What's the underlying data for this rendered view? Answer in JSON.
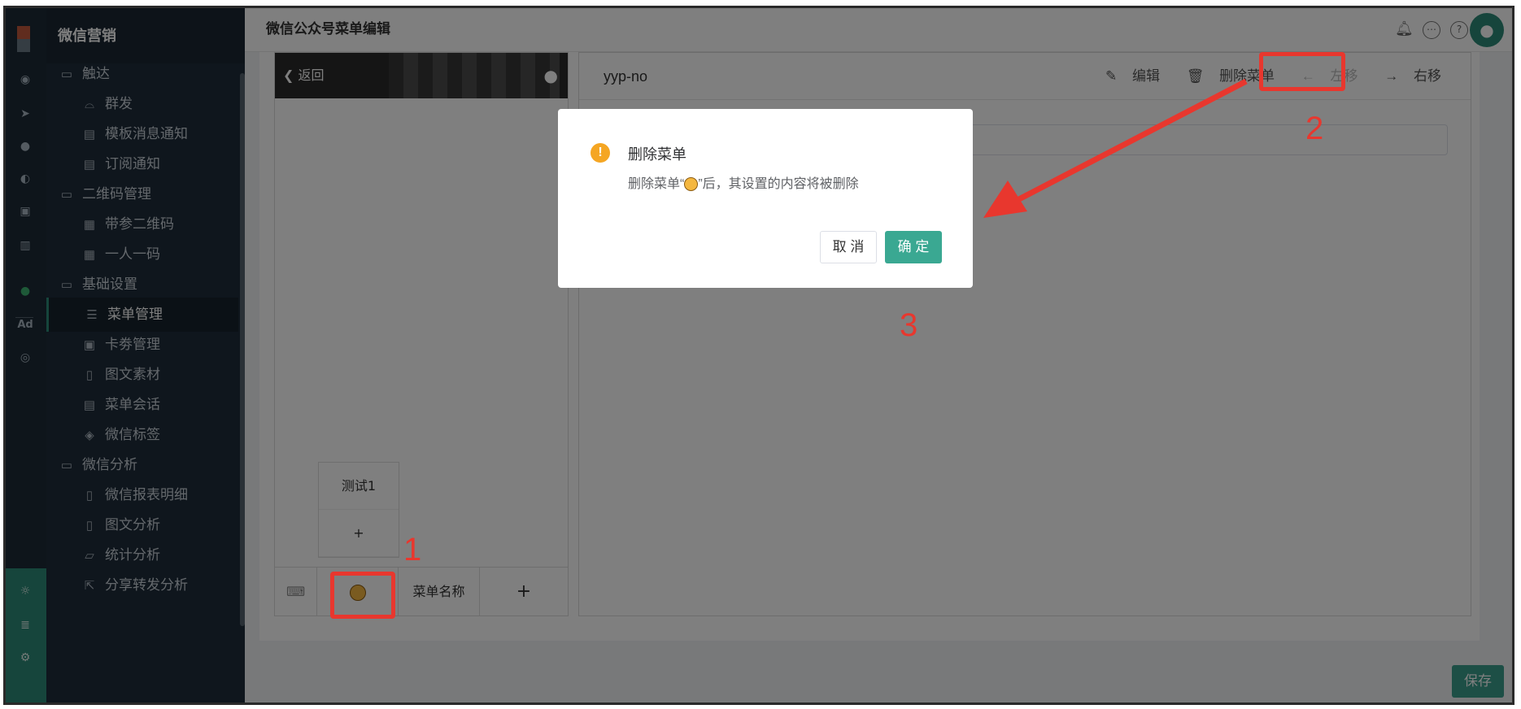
{
  "sidebar": {
    "brand": "微信营销",
    "items": [
      {
        "label": "触达",
        "icon": "folder-icon"
      },
      {
        "label": "群发",
        "icon": "broadcast-icon"
      },
      {
        "label": "模板消息通知",
        "icon": "template-icon"
      },
      {
        "label": "订阅通知",
        "icon": "subscribe-icon"
      },
      {
        "label": "二维码管理",
        "icon": "folder-icon"
      },
      {
        "label": "带参二维码",
        "icon": "qrcode-icon"
      },
      {
        "label": "一人一码",
        "icon": "qrcode-icon"
      },
      {
        "label": "基础设置",
        "icon": "folder-icon"
      },
      {
        "label": "菜单管理",
        "icon": "list-icon"
      },
      {
        "label": "卡劵管理",
        "icon": "card-icon"
      },
      {
        "label": "图文素材",
        "icon": "article-icon"
      },
      {
        "label": "菜单会话",
        "icon": "chat-icon"
      },
      {
        "label": "微信标签",
        "icon": "tag-icon"
      },
      {
        "label": "微信分析",
        "icon": "folder-icon"
      },
      {
        "label": "微信报表明细",
        "icon": "report-icon"
      },
      {
        "label": "图文分析",
        "icon": "report-icon"
      },
      {
        "label": "统计分析",
        "icon": "chart-icon"
      },
      {
        "label": "分享转发分析",
        "icon": "share-icon"
      }
    ],
    "rail_ad": "Ad"
  },
  "header": {
    "title": "微信公众号菜单编辑"
  },
  "phone": {
    "back": "返回",
    "submenu": [
      "测试1",
      "+"
    ],
    "menu_name": "菜单名称",
    "add": "+"
  },
  "editor": {
    "title": "yyp-no",
    "actions": {
      "edit": "编辑",
      "delete": "删除菜单",
      "left": "左移",
      "right": "右移"
    }
  },
  "save_label": "保存",
  "dialog": {
    "title": "删除菜单",
    "message_prefix": "删除菜单“",
    "message_suffix": "”后，其设置的内容将被删除",
    "cancel": "取 消",
    "ok": "确 定",
    "warn_glyph": "!"
  },
  "annotations": {
    "one": "1",
    "two": "2",
    "three": "3",
    "color": "#e8372e"
  },
  "colors": {
    "accent": "#2d8a78",
    "sidebar": "#1f2d3a",
    "warning": "#f5a623"
  }
}
